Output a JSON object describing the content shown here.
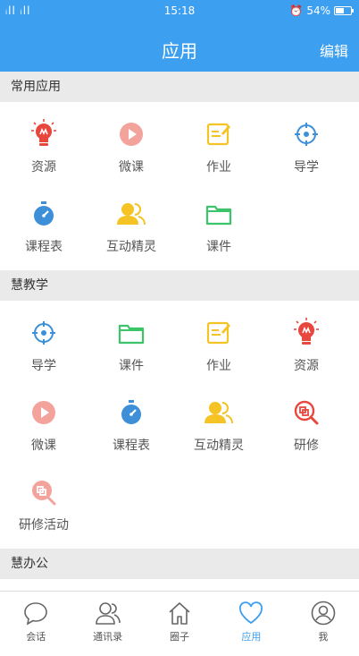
{
  "status_bar": {
    "signal": "ᵢll ᵢll",
    "time": "15:18",
    "battery": "54%"
  },
  "header": {
    "title": "应用",
    "edit_label": "编辑"
  },
  "sections": [
    {
      "title": "常用应用",
      "items": [
        {
          "label": "资源",
          "icon": "lightbulb-icon"
        },
        {
          "label": "微课",
          "icon": "play-icon"
        },
        {
          "label": "作业",
          "icon": "edit-icon"
        },
        {
          "label": "导学",
          "icon": "target-icon"
        },
        {
          "label": "课程表",
          "icon": "stopwatch-icon"
        },
        {
          "label": "互动精灵",
          "icon": "users-icon"
        },
        {
          "label": "课件",
          "icon": "folder-icon"
        }
      ]
    },
    {
      "title": "慧教学",
      "items": [
        {
          "label": "导学",
          "icon": "target-icon"
        },
        {
          "label": "课件",
          "icon": "folder-icon"
        },
        {
          "label": "作业",
          "icon": "edit-icon"
        },
        {
          "label": "资源",
          "icon": "lightbulb-icon"
        },
        {
          "label": "微课",
          "icon": "play-icon"
        },
        {
          "label": "课程表",
          "icon": "stopwatch-icon"
        },
        {
          "label": "互动精灵",
          "icon": "users-icon"
        },
        {
          "label": "研修",
          "icon": "research-icon"
        },
        {
          "label": "研修活动",
          "icon": "research-activity-icon"
        }
      ]
    },
    {
      "title": "慧办公",
      "items": []
    }
  ],
  "tabs": [
    {
      "label": "会话",
      "icon": "chat-icon"
    },
    {
      "label": "通讯录",
      "icon": "contacts-icon"
    },
    {
      "label": "圈子",
      "icon": "home-icon"
    },
    {
      "label": "应用",
      "icon": "heart-icon",
      "active": true
    },
    {
      "label": "我",
      "icon": "profile-icon"
    }
  ],
  "colors": {
    "primary": "#3d9ff0",
    "red": "#e8473e",
    "pink": "#f4a39c",
    "yellow": "#f5c324",
    "blue": "#3d8fd8",
    "green": "#3cc46a"
  }
}
